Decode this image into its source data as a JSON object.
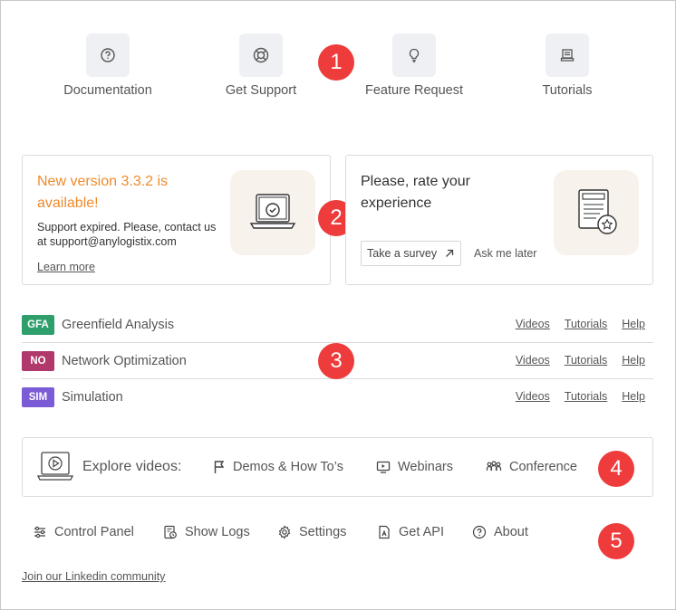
{
  "quick_links": [
    {
      "label": "Documentation",
      "icon": "question-icon"
    },
    {
      "label": "Get Support",
      "icon": "lifebuoy-icon"
    },
    {
      "label": "Feature Request",
      "icon": "lightbulb-icon"
    },
    {
      "label": "Tutorials",
      "icon": "book-icon"
    }
  ],
  "badges": [
    "1",
    "2",
    "3",
    "4",
    "5"
  ],
  "version_card": {
    "title": "New version 3.3.2 is available!",
    "text": "Support expired. Please, contact us at support@anylogistix.com",
    "link": "Learn more"
  },
  "rate_card": {
    "title": "Please, rate your experience",
    "survey_label": "Take a survey",
    "later_label": "Ask me later"
  },
  "experiments": [
    {
      "tag": "GFA",
      "name": "Greenfield Analysis",
      "color": "#2e9e6b",
      "links": [
        "Videos",
        "Tutorials",
        "Help"
      ]
    },
    {
      "tag": "NO",
      "name": "Network Optimization",
      "color": "#b0386b",
      "links": [
        "Videos",
        "Tutorials",
        "Help"
      ]
    },
    {
      "tag": "SIM",
      "name": "Simulation",
      "color": "#7b5cd6",
      "links": [
        "Videos",
        "Tutorials",
        "Help"
      ]
    }
  ],
  "explore": {
    "label": "Explore videos:",
    "links": [
      "Demos & How To’s",
      "Webinars",
      "Conference"
    ]
  },
  "tools": [
    "Control Panel",
    "Show Logs",
    "Settings",
    "Get API",
    "About"
  ],
  "linkedin": "Join our Linkedin community",
  "colors": {
    "accent_orange": "#ef8a2c",
    "badge_red": "#ee3b3b"
  }
}
